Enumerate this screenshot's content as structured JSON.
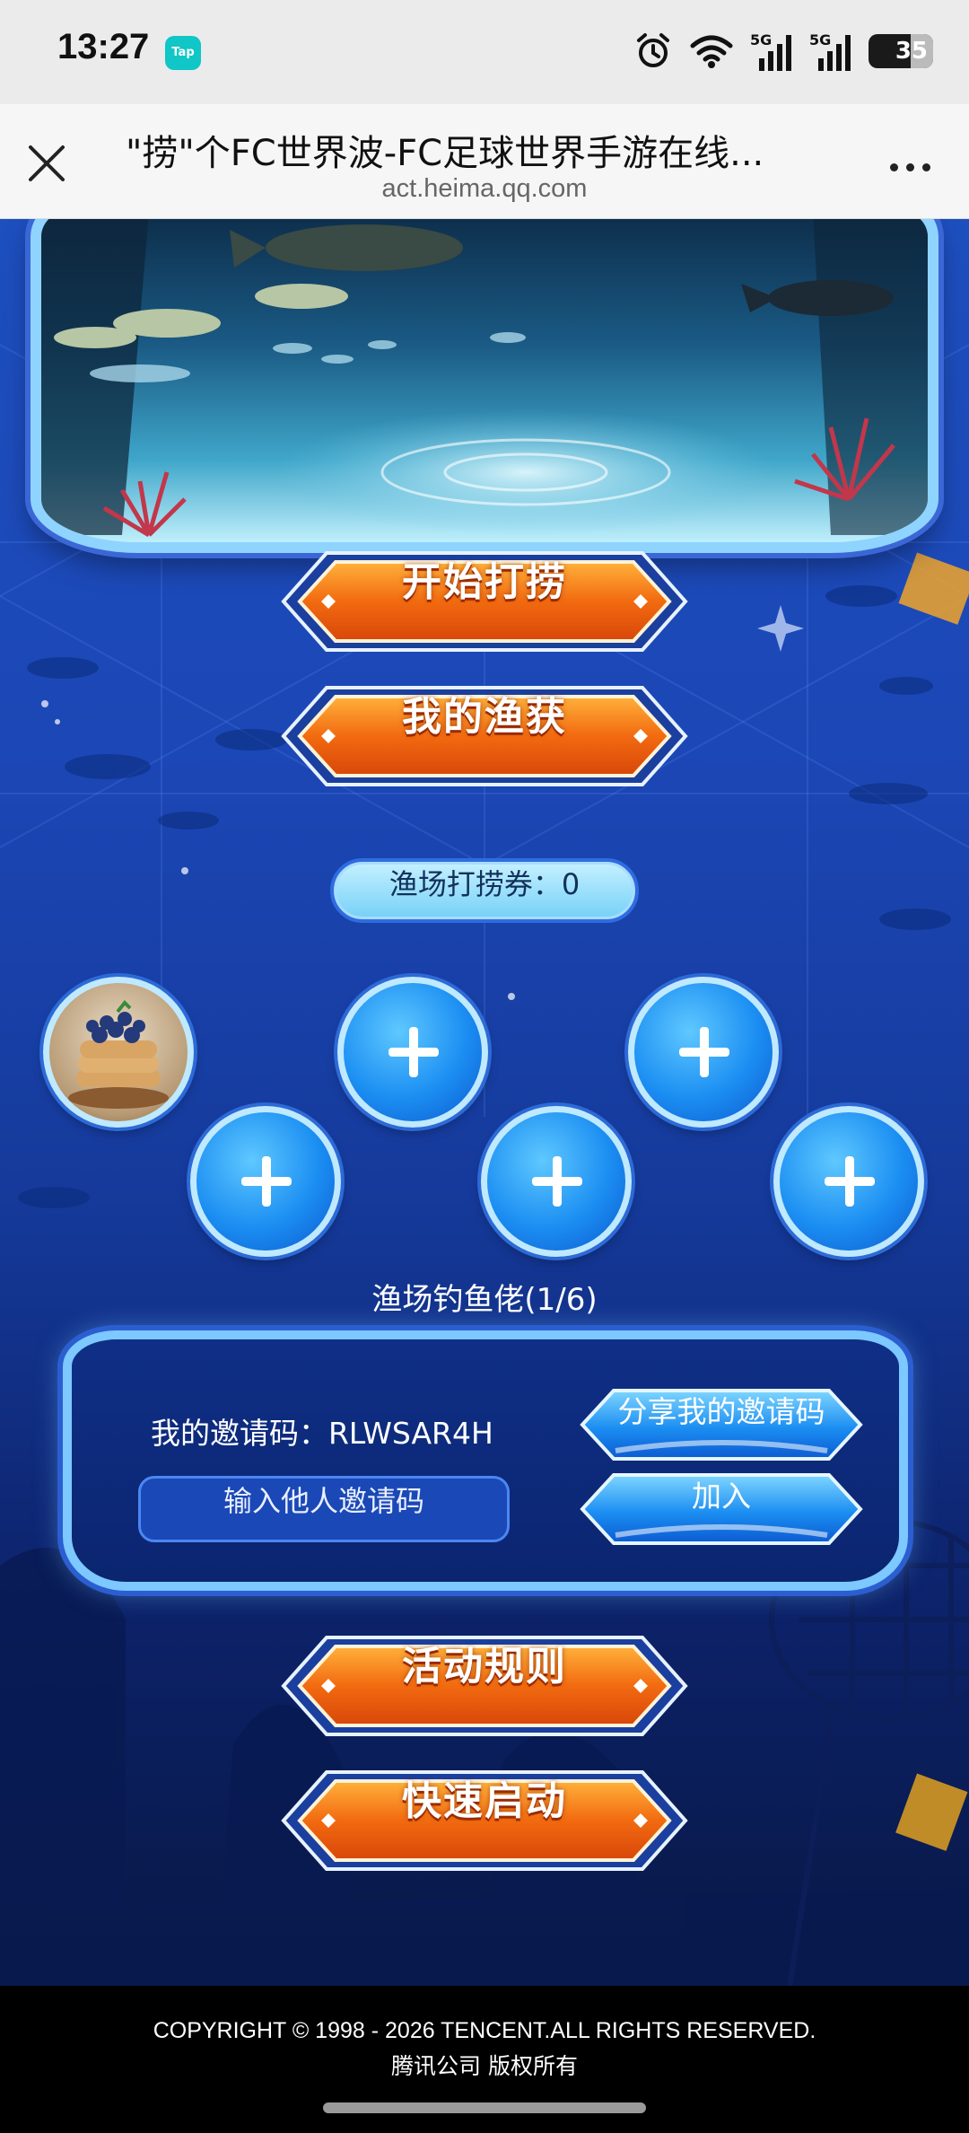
{
  "status_bar": {
    "time": "13:27",
    "app_badge": "Tap",
    "network_1": "5G",
    "network_2": "5G",
    "battery": "35",
    "battery_level": 0.35,
    "icons": [
      "alarm-icon",
      "wifi-icon",
      "signal-5g-icon",
      "signal-5g-icon",
      "battery-icon"
    ]
  },
  "browser": {
    "title": "\"捞\"个FC世界波-FC足球世界手游在线...",
    "url": "act.heima.qq.com",
    "close_icon": "close-icon",
    "more_icon": "more-icon"
  },
  "buttons": {
    "start_fishing": "开始打捞",
    "my_catch": "我的渔获",
    "rules": "活动规则",
    "quick_start": "快速启动"
  },
  "ticket": {
    "label": "渔场打捞券：",
    "count": "0"
  },
  "squad": {
    "label": "渔场钓鱼佬(1/6)",
    "slots": [
      "avatar",
      "add",
      "add",
      "add",
      "add",
      "add"
    ]
  },
  "invite": {
    "my_code_label": "我的邀请码：",
    "my_code": "RLWSAR4H",
    "share_button": "分享我的邀请码",
    "input_placeholder": "输入他人邀请码",
    "join_button": "加入"
  },
  "footer": {
    "copyright": "COPYRIGHT © 1998 - 2026 TENCENT.ALL RIGHTS RESERVED.",
    "company": "腾讯公司 版权所有"
  },
  "colors": {
    "background": "#1c47b6",
    "orange_button": "#f26a10",
    "blue_button": "#1b8ef2",
    "panel_border": "#7cc8ff"
  }
}
